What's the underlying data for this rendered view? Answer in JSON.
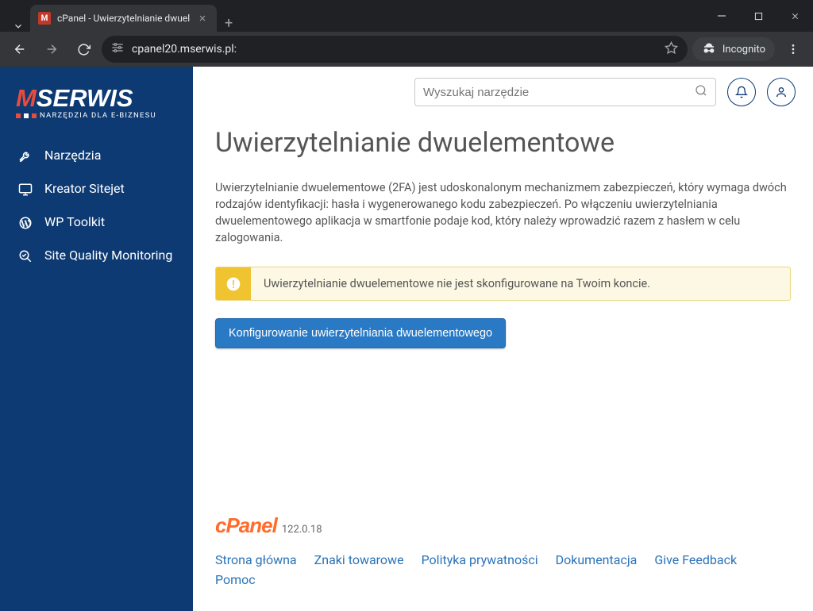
{
  "browser": {
    "tab_title": "cPanel - Uwierzytelnianie dwuel",
    "url": "cpanel20.mserwis.pl:",
    "incognito_label": "Incognito"
  },
  "brand": {
    "name_m": "M",
    "name_rest": "SERWIS",
    "tagline": "NARZĘDZIA DLA E-BIZNESU"
  },
  "sidebar": {
    "items": [
      {
        "label": "Narzędzia",
        "icon": "tools"
      },
      {
        "label": "Kreator Sitejet",
        "icon": "monitor"
      },
      {
        "label": "WP Toolkit",
        "icon": "wordpress"
      },
      {
        "label": "Site Quality Monitoring",
        "icon": "magnifier-check"
      }
    ]
  },
  "topbar": {
    "search_placeholder": "Wyszukaj narzędzie"
  },
  "page": {
    "title": "Uwierzytelnianie dwuelementowe",
    "description": "Uwierzytelnianie dwuelementowe (2FA) jest udoskonalonym mechanizmem zabezpieczeń, który wymaga dwóch rodzajów identyfikacji: hasła i wygenerowanego kodu zabezpieczeń. Po włączeniu uwierzytelniania dwuelementowego aplikacja w smartfonie podaje kod, który należy wprowadzić razem z hasłem w celu zalogowania.",
    "alert_message": "Uwierzytelnianie dwuelementowe nie jest skonfigurowane na Twoim koncie.",
    "primary_button": "Konfigurowanie uwierzytelniania dwuelementowego"
  },
  "footer": {
    "logo_text": "cPanel",
    "version": "122.0.18",
    "links": [
      "Strona główna",
      "Znaki towarowe",
      "Polityka prywatności",
      "Dokumentacja",
      "Give Feedback",
      "Pomoc"
    ]
  }
}
